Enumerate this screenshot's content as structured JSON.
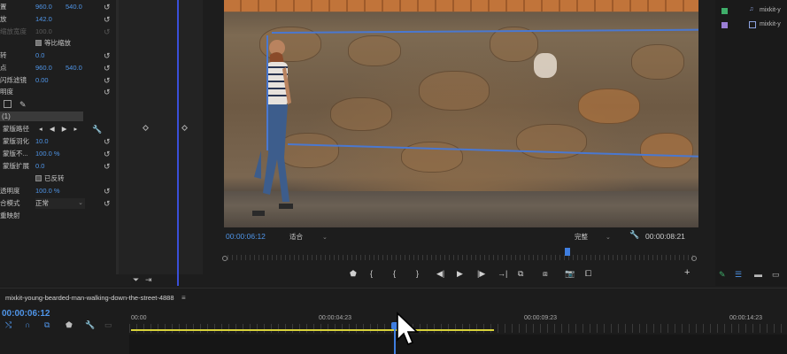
{
  "effect_controls": {
    "rows": [
      {
        "label": "置",
        "v1": "960.0",
        "v2": "540.0"
      },
      {
        "label": "放",
        "v1": "142.0",
        "v2": ""
      },
      {
        "label": "缩放宽度",
        "v1": "100.0",
        "v2": "",
        "dim": true
      },
      {
        "label": "",
        "checkbox_label": "等比缩放",
        "checked": true
      },
      {
        "label": "转",
        "v1": "0.0",
        "v2": ""
      },
      {
        "label": "点",
        "v1": "960.0",
        "v2": "540.0"
      },
      {
        "label": "闪烁滤镜",
        "v1": "0.00",
        "v2": ""
      },
      {
        "label": "明度",
        "v1": "",
        "v2": ""
      }
    ],
    "mask_header": "(1)",
    "mask_rows": [
      {
        "label": "蒙版路径",
        "v1": "",
        "v2": ""
      },
      {
        "label": "蒙版羽化",
        "v1": "10.0",
        "v2": ""
      },
      {
        "label": "蒙版不...",
        "v1": "100.0 %",
        "v2": ""
      },
      {
        "label": "蒙版扩展",
        "v1": "0.0",
        "v2": ""
      },
      {
        "label": "",
        "checkbox_label": "已反转",
        "checked": false
      },
      {
        "label": "透明度",
        "v1": "100.0 %",
        "v2": ""
      },
      {
        "label": "合模式",
        "v1": "正常",
        "v2": ""
      },
      {
        "label": "重映射",
        "v1": "",
        "v2": ""
      }
    ]
  },
  "program_monitor": {
    "timecode_current": "00:00:06:12",
    "fit": "适合",
    "quality": "完整",
    "timecode_duration": "00:00:08:21"
  },
  "project": {
    "items": [
      {
        "name": "mixkit-y",
        "color": "#3fae6a"
      },
      {
        "name": "mixkit-y",
        "color": "#9b7fd6"
      }
    ]
  },
  "timeline": {
    "sequence_name": "mixkit-young-bearded-man-walking-down-the-street-4888",
    "menu_glyph": "≡",
    "timecode": "00:00:06:12",
    "ruler_labels": [
      "00:00",
      "00:00:04:23",
      "00:00:09:23",
      "00:00:14:23"
    ]
  },
  "colors": {
    "accent_blue": "#4f95e8",
    "work_area_yellow": "#d8d23a",
    "playhead_blue": "#3f7ee0"
  }
}
